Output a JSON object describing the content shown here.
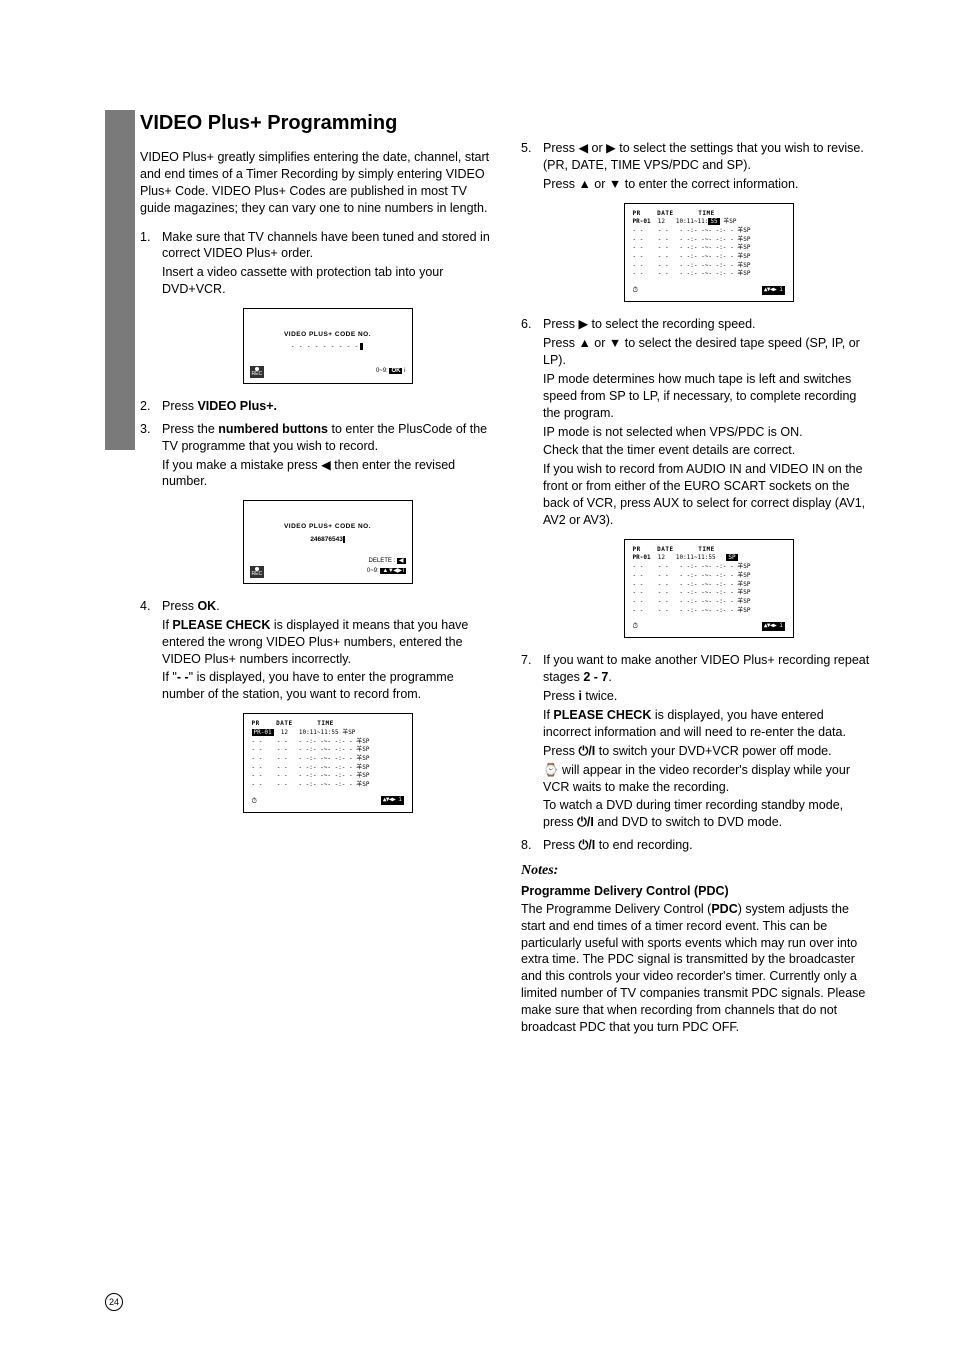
{
  "title": "VIDEO Plus+ Programming",
  "intro": "VIDEO Plus+ greatly simplifies entering the date, channel, start and end times of a Timer Recording by simply entering VIDEO Plus+ Code. VIDEO Plus+ Codes are published in most TV guide magazines; they can vary one to nine numbers in length.",
  "left": {
    "s1a": "Make sure that TV channels have been tuned and stored in correct VIDEO Plus+ order.",
    "s1b": "Insert a video cassette with protection tab into your DVD+VCR.",
    "screen1": {
      "title": "VIDEO PLUS+ CODE NO.",
      "code": "- - - - - - - - -",
      "right": "0~9:",
      "ok": "OK",
      "i": "i"
    },
    "s2_pre": "Press ",
    "s2_b": "VIDEO Plus+.",
    "s3_pre": "Press the ",
    "s3_b": "numbered buttons",
    "s3_post": " to enter the PlusCode of the TV programme that you wish to record.",
    "s3c_pre": "If you make a mistake press ",
    "s3c_post": " then enter the revised number.",
    "screen2": {
      "title": "VIDEO PLUS+ CODE NO.",
      "code": "246876543",
      "del": "DELETE :",
      "right": "0~9:"
    },
    "s4_pre": "Press ",
    "s4_b": "OK",
    "s4_post": ".",
    "s4a_pre": "If ",
    "s4a_b": "PLEASE CHECK",
    "s4a_post": " is displayed it means that you have entered the wrong VIDEO Plus+ numbers, entered the VIDEO Plus+ numbers incorrectly.",
    "s4b_pre": "If \"",
    "s4b_b": "- -",
    "s4b_post": "\" is displayed, you have to enter the programme number of the station, you want to record from.",
    "timer1": {
      "hdr": "PR    DATE      TIME",
      "r1": "PR-01  12   10:11~11:55 羊SP",
      "rblank": "- -    - -   - -:- -~- -:- - 羊SP",
      "arrows": "▲▼◀▶ i"
    }
  },
  "right": {
    "s5a_pre": "Press ",
    "s5a_mid": " or ",
    "s5a_post": " to select the settings that you wish to revise. (PR, DATE, TIME VPS/PDC and SP).",
    "s5b_pre": "Press ",
    "s5b_mid": " or ",
    "s5b_post": " to enter the correct information.",
    "s6a_pre": "Press ",
    "s6a_post": " to select the recording speed.",
    "s6b_pre": "Press ",
    "s6b_mid": " or ",
    "s6b_post": " to select the desired tape speed (SP, IP, or LP).",
    "s6c": "IP mode determines how much tape is left and switches speed from SP to LP, if necessary, to complete recording the program.",
    "s6d": "IP mode is not selected when VPS/PDC is ON.",
    "s6e": "Check that the timer event details are correct.",
    "s6f": "If you wish to record from AUDIO IN and VIDEO IN on the front or from either of the EURO SCART sockets on the back of VCR, press AUX to select for correct display (AV1, AV2 or AV3).",
    "s7a_pre": "If you want to make another VIDEO Plus+ recording repeat stages ",
    "s7a_b": "2 - 7",
    "s7a_post": ".",
    "s7b_pre": "Press ",
    "s7b_b": "i",
    "s7b_post": " twice.",
    "s7c_pre": "If ",
    "s7c_b": "PLEASE CHECK",
    "s7c_post": " is displayed, you have entered incorrect information and will need to re-enter the data.",
    "s7d_pre": "Press ",
    "s7d_post": " to switch your DVD+VCR power off mode.",
    "s7e": " will appear in the video recorder's display while your VCR waits to make the recording.",
    "s7f_pre": "To watch a DVD during timer recording standby mode, press ",
    "s7f_post": " and DVD to switch to DVD mode.",
    "s8_pre": "Press ",
    "s8_post": " to end recording.",
    "notes": "Notes:",
    "pdc_head": "Programme Delivery Control (PDC)",
    "pdc_body_a": "The Programme Delivery Control (",
    "pdc_body_b": "PDC",
    "pdc_body_c": ") system adjusts the start and end times of a timer record event. This can be particularly useful with sports events which may run over into extra time. The PDC signal is transmitted by the broadcaster and this controls your video recorder's timer. Currently only a limited number of TV companies transmit PDC signals. Please make sure that when recording from channels that do not broadcast PDC that you turn PDC OFF."
  },
  "glyphs": {
    "left": "◀",
    "right": "▶",
    "up": "▲",
    "down": "▼",
    "power": "⏻/I",
    "clock": "⏱",
    "clock2": "⌚"
  },
  "page": "24"
}
